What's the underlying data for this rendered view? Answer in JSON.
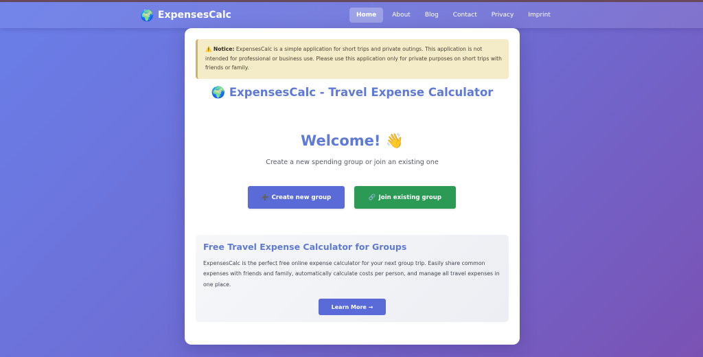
{
  "brand": {
    "icon": "🌍",
    "name": "ExpensesCalc"
  },
  "nav": {
    "items": [
      "Home",
      "About",
      "Blog",
      "Contact",
      "Privacy",
      "Imprint"
    ],
    "active": "Home"
  },
  "notice": {
    "icon": "⚠️",
    "label": "Notice:",
    "text": "ExpensesCalc is a simple application for short trips and private outings. This application is not intended for professional or business use. Please use this application only for private purposes on short trips with friends or family."
  },
  "page_title": "🌍 ExpensesCalc - Travel Expense Calculator",
  "welcome": {
    "heading": "Welcome! 👋",
    "subtitle": "Create a new spending group or join an existing one"
  },
  "actions": {
    "create": {
      "icon": "➕",
      "label": "Create new group"
    },
    "join": {
      "icon": "🔗",
      "label": "Join existing group"
    }
  },
  "info": {
    "heading": "Free Travel Expense Calculator for Groups",
    "text": "ExpensesCalc is the perfect free online expense calculator for your next group trip. Easily share common expenses with friends and family, automatically calculate costs per person, and manage all travel expenses in one place.",
    "button": "Learn More →"
  },
  "colors": {
    "accent": "#5f7ad6",
    "primary_button": "#5a6ad6",
    "success_button": "#2a9a55",
    "notice_bg": "#f4ebc8"
  }
}
